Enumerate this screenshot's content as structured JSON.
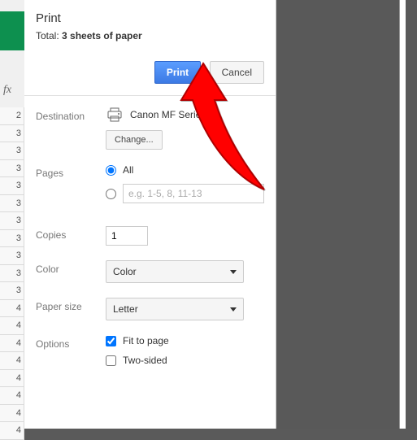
{
  "header": {
    "title": "Print",
    "total_prefix": "Total: ",
    "total_value": "3 sheets of paper"
  },
  "actions": {
    "print": "Print",
    "cancel": "Cancel"
  },
  "destination": {
    "label": "Destination",
    "printer_name": "Canon MF          Series ...",
    "change": "Change..."
  },
  "pages": {
    "label": "Pages",
    "all": "All",
    "range_placeholder": "e.g. 1-5, 8, 11-13"
  },
  "copies": {
    "label": "Copies",
    "value": "1"
  },
  "color": {
    "label": "Color",
    "value": "Color"
  },
  "paper": {
    "label": "Paper size",
    "value": "Letter"
  },
  "options": {
    "label": "Options",
    "fit": "Fit to page",
    "twosided": "Two-sided"
  },
  "bg": {
    "fx": "fx",
    "rows": [
      "2",
      "3",
      "3",
      "3",
      "3",
      "3",
      "3",
      "3",
      "3",
      "3",
      "3",
      "4",
      "4",
      "4",
      "4",
      "4",
      "4",
      "4",
      "4"
    ]
  }
}
